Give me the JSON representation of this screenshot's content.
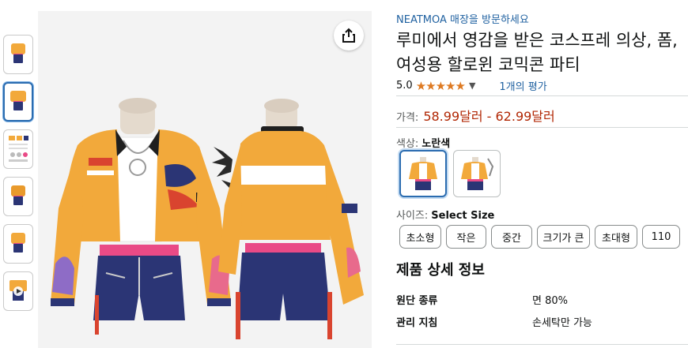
{
  "store": {
    "link_text": "NEATMOA 매장을 방문하세요"
  },
  "product": {
    "title": "루미에서 영감을 받은 코스프레 의상, 폼, 여성용 할로윈 코믹콘 파티",
    "rating_value": "5.0",
    "stars": "★★★★★",
    "reviews_text": "1개의 평가"
  },
  "price": {
    "label": "가격:",
    "value": "58.99달러 - 62.99달러"
  },
  "color": {
    "label": "색상:",
    "selected": "노란색"
  },
  "size": {
    "label": "사이즈:",
    "selected": "Select Size",
    "options": [
      "초소형",
      "작은",
      "중간",
      "크기가 큰",
      "초대형",
      "110"
    ]
  },
  "details": {
    "title": "제품 상세 정보",
    "rows": [
      {
        "key": "원단 종류",
        "value": "면 80%"
      },
      {
        "key": "관리 지침",
        "value": "손세탁만 가능"
      }
    ]
  },
  "icons": {
    "share": "share-icon",
    "chevron": "chevron-down-icon"
  },
  "colors": {
    "accent": "#2162a1",
    "price": "#b12704",
    "star": "#de7921",
    "jacket": "#f2a93b",
    "shorts": "#2b3575",
    "belt": "#e94a86"
  }
}
